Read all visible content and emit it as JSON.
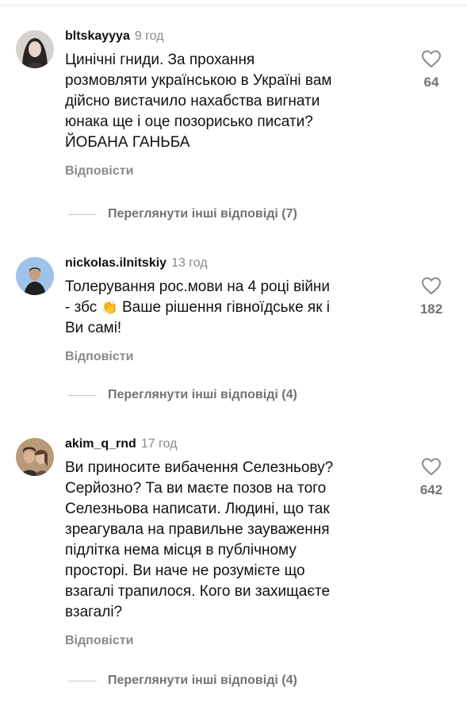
{
  "comments": [
    {
      "username": "bltskayyya",
      "time": "9 год",
      "text": "Цинічні гниди. За прохання\nрозмовляти українською в Україні вам\nдійсно вистачило нахабства вигнати\nюнака ще і оце позорисько писати?\nЙОБАНА ГАНЬБА",
      "reply_label": "Відповісти",
      "likes": "64",
      "more_replies": "Переглянути інші відповіді (7)",
      "avatar_icon": "user-avatar-photo"
    },
    {
      "username": "nickolas.ilnitskiy",
      "time": "13 год",
      "text_before_emoji": "Толерування рос.мови на 4 році війни\n- збс ",
      "emoji": "👏",
      "text_after_emoji": " Ваше рішення гівноїдське як і\nВи самі!",
      "reply_label": "Відповісти",
      "likes": "182",
      "more_replies": "Переглянути інші відповіді (4)",
      "avatar_icon": "user-avatar-photo"
    },
    {
      "username": "akim_q_rnd",
      "time": "17 год",
      "text": "Ви приносите вибачення Селезньову?\nСерйозно? Та ви маєте позов на того\nСелезньова написати. Людині, що так\nзреагувала на правильне зауваження\nпідлітка нема місця в публічному\nпросторі. Ви наче не розумієте що\nвзагалі трапилося. Кого ви захищаєте\nвзагалі?",
      "reply_label": "Відповісти",
      "likes": "642",
      "more_replies": "Переглянути інші відповіді (4)",
      "avatar_icon": "user-avatar-photo"
    }
  ],
  "icons": {
    "like": "heart-icon"
  },
  "colors": {
    "muted": "#8a8a8a",
    "text": "#111111"
  }
}
